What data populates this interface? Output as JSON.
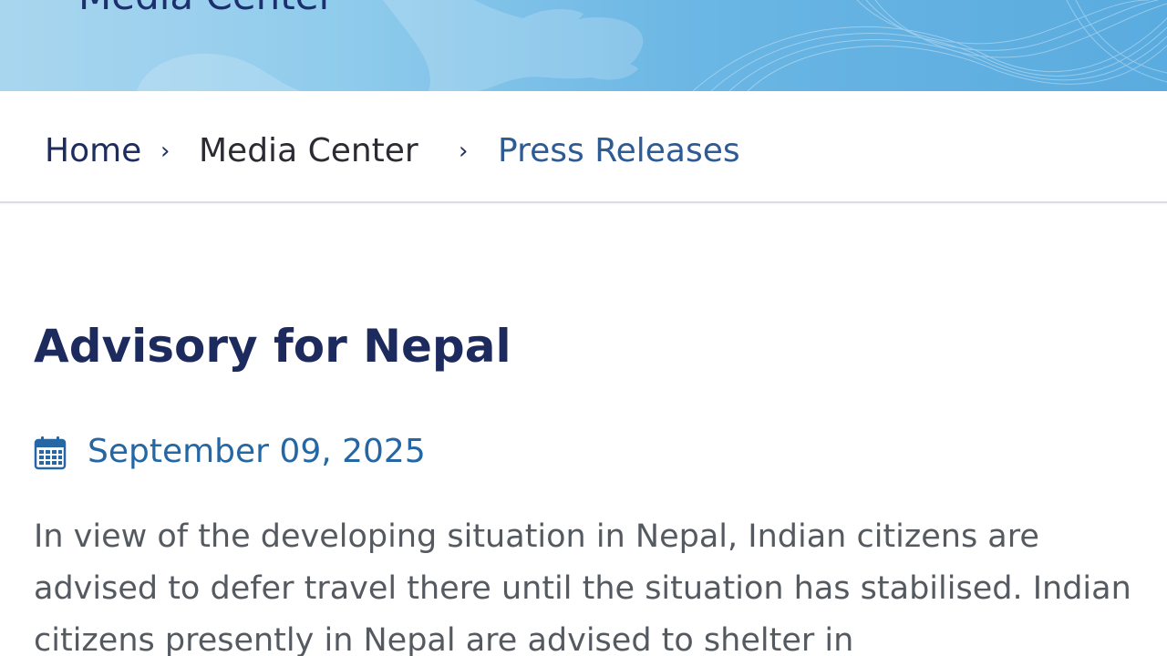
{
  "banner": {
    "title": "Media Center"
  },
  "breadcrumb": {
    "items": [
      {
        "label": "Home"
      },
      {
        "label": "Media Center"
      },
      {
        "label": "Press Releases"
      }
    ],
    "separator": "›"
  },
  "article": {
    "title": "Advisory for Nepal",
    "date": "September 09, 2025",
    "body": "In view of the developing situation in Nepal, Indian citizens are advised to defer travel there until the situation has stabilised. Indian citizens presently in Nepal are advised to shelter in"
  },
  "icons": {
    "calendar": "calendar-icon"
  },
  "colors": {
    "banner_title": "#1c2f6e",
    "breadcrumb_active": "#2e5b94",
    "heading": "#1c2a5e",
    "date": "#2567a4",
    "body_text": "#555a61"
  }
}
